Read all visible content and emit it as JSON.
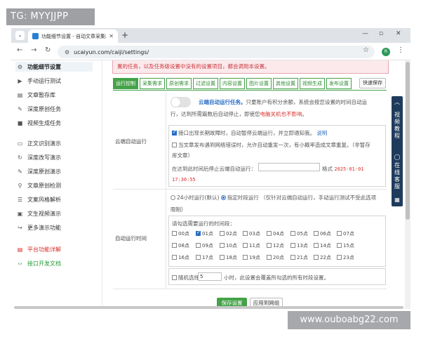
{
  "watermark": {
    "top": "TG: MYYJJPP",
    "bottom": "www.ouboabg22.com"
  },
  "browser": {
    "tab_title": "功能细节设置 - 自动文章采集助手",
    "url": "ucaiyun.com/caiji/settings/",
    "avatar_letter": "R"
  },
  "sidebar": {
    "items": [
      {
        "label": "功能细节设置",
        "icon": "cogs-icon"
      },
      {
        "label": "手动运行测试",
        "icon": "play-icon"
      },
      {
        "label": "文章暂存库",
        "icon": "archive-icon"
      },
      {
        "label": "深度原创任务",
        "icon": "edit-icon"
      },
      {
        "label": "视频生成任务",
        "icon": "video-icon"
      },
      {
        "label": "正文识别演示",
        "icon": "monitor-icon"
      },
      {
        "label": "深度改写演示",
        "icon": "refresh-icon"
      },
      {
        "label": "深度原创演示",
        "icon": "pen-icon"
      },
      {
        "label": "文章原创检测",
        "icon": "search-icon"
      },
      {
        "label": "文案风格解析",
        "icon": "list-icon"
      },
      {
        "label": "文生视频演示",
        "icon": "film-icon"
      },
      {
        "label": "更多演示功能",
        "icon": "share-icon"
      },
      {
        "label": "平台功能详解",
        "icon": "doc-icon"
      },
      {
        "label": "接口开发文档",
        "icon": "code-icon"
      }
    ]
  },
  "alert_text": "置的任务，以及任务级设置中没有的设置项目，都会调用本设置。",
  "tabs": [
    "运行控制",
    "采集需求",
    "原创需求",
    "过滤设置",
    "内容设置",
    "图片设置",
    "其他设置",
    "视频生成",
    "发布设置"
  ],
  "quick_save": "快速保存",
  "cloud": {
    "label": "云端自动运行",
    "toggle_title": "云端自动运行任务。",
    "desc1": "只要账户有积分余额，系统会按您设置的时间自动运",
    "desc2": "行，达到所需篇数后自动停止，即使您",
    "desc2_red": "电脑关机也不影响",
    "desc2_end": "。",
    "opt1": "接口出现长期故障时，自动暂停云端运行，并立即通知我。",
    "opt1_link": "说明",
    "opt2a": "当文章发布遇到网络错误时，允许自动重发一次，有小概率造成文章重复。（非暂存",
    "opt2b": "库文章）",
    "stop_label": "在达到此时间后停止云端自动运行：",
    "format_label": "格式",
    "format_example1": "2025-01-01",
    "format_example2": "17:30:55"
  },
  "auto_run": {
    "label": "自动运行时间",
    "mode_24h": "24小时运行(默认)",
    "mode_timed": "指定时段运行",
    "mode_note1": "（仅针对云端自动运行，手动运行测试不受此选项",
    "mode_note2": "限制）",
    "select_title": "请勾选需要运行的时间段：",
    "hours": [
      "00点",
      "01点",
      "02点",
      "03点",
      "04点",
      "05点",
      "06点",
      "07点",
      "08点",
      "09点",
      "10点",
      "11点",
      "12点",
      "13点",
      "14点",
      "15点",
      "16点",
      "17点",
      "18点",
      "19点",
      "20点",
      "21点",
      "22点",
      "23点"
    ],
    "checked_hour": "01点",
    "random_label": "随机选择",
    "random_value": "5",
    "random_suffix": "小时，此设置会覆盖所勾选的所有时段设置。"
  },
  "buttons": {
    "save": "保存设置",
    "apply": "应用到网组"
  },
  "float_panel": {
    "up": "︿",
    "label1": "视频教程",
    "label2": "在线客服",
    "qr": "▦"
  }
}
